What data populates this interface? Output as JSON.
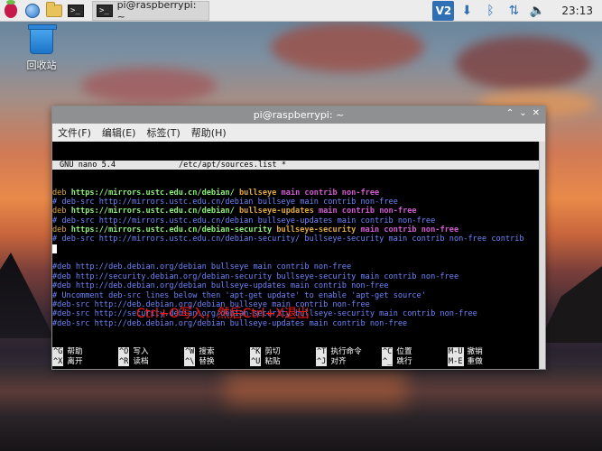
{
  "taskbar": {
    "launchers": [
      "raspberry-menu",
      "web-browser",
      "file-manager",
      "terminal"
    ],
    "active_task": "pi@raspberrypi: ~",
    "tray": {
      "vnc_label": "V2",
      "clock": "23:13"
    }
  },
  "desktop": {
    "icons": [
      {
        "label": "回收站",
        "icon": "trash-icon"
      }
    ]
  },
  "terminal": {
    "title": "pi@raspberrypi: ~",
    "menu": [
      "文件(F)",
      "编辑(E)",
      "标签(T)",
      "帮助(H)"
    ],
    "nano_header": {
      "version": "GNU nano 5.4",
      "file": "/etc/apt/sources.list *"
    },
    "lines": [
      [
        {
          "t": "deb ",
          "c": "deb"
        },
        {
          "t": "https://mirrors.ustc.edu.cn/debian/ ",
          "c": "url"
        },
        {
          "t": "bullseye ",
          "c": "dist"
        },
        {
          "t": "main contrib non-free",
          "c": "comp"
        }
      ],
      [
        {
          "t": "# deb-src http://mirrors.ustc.edu.cn/debian bullseye main contrib non-free",
          "c": "comment"
        }
      ],
      [
        {
          "t": "deb ",
          "c": "deb"
        },
        {
          "t": "https://mirrors.ustc.edu.cn/debian/ ",
          "c": "url"
        },
        {
          "t": "bullseye-updates ",
          "c": "dist"
        },
        {
          "t": "main contrib non-free",
          "c": "comp"
        }
      ],
      [
        {
          "t": "# deb-src http://mirrors.ustc.edu.cn/debian bullseye-updates main contrib non-free",
          "c": "comment"
        }
      ],
      [
        {
          "t": "deb ",
          "c": "deb"
        },
        {
          "t": "https://mirrors.ustc.edu.cn/debian-security ",
          "c": "url"
        },
        {
          "t": "bullseye-security ",
          "c": "dist"
        },
        {
          "t": "main contrib non-free",
          "c": "comp"
        }
      ],
      [
        {
          "t": "# deb-src http://mirrors.ustc.edu.cn/debian-security/ bullseye-security main contrib non-free contrib",
          "c": "comment"
        }
      ],
      [
        {
          "t": "",
          "c": "cursor"
        }
      ],
      [
        {
          "t": "",
          "c": "plain"
        }
      ],
      [
        {
          "t": "#deb http://deb.debian.org/debian bullseye main contrib non-free",
          "c": "comment"
        }
      ],
      [
        {
          "t": "#deb http://security.debian.org/debian-security bullseye-security main contrib non-free",
          "c": "comment"
        }
      ],
      [
        {
          "t": "#deb http://deb.debian.org/debian bullseye-updates main contrib non-free",
          "c": "comment"
        }
      ],
      [
        {
          "t": "# Uncomment deb-src lines below then 'apt-get update' to enable 'apt-get source'",
          "c": "comment"
        }
      ],
      [
        {
          "t": "#deb-src http://deb.debian.org/debian bullseye main contrib non-free",
          "c": "comment"
        }
      ],
      [
        {
          "t": "#deb-src http://security.debian.org/debian-security bullseye-security main contrib non-free",
          "c": "comment"
        }
      ],
      [
        {
          "t": "#deb-src http://deb.debian.org/debian bullseye-updates main contrib non-free",
          "c": "comment"
        }
      ]
    ],
    "annotation": "Ctrl+O写入，然后Ctrl+X退出",
    "shortcuts": [
      [
        {
          "k": "^G",
          "l": "帮助"
        },
        {
          "k": "^O",
          "l": "写入"
        },
        {
          "k": "^W",
          "l": "搜索"
        },
        {
          "k": "^K",
          "l": "剪切"
        },
        {
          "k": "^T",
          "l": "执行命令"
        },
        {
          "k": "^C",
          "l": "位置"
        },
        {
          "k": "M-U",
          "l": "撤销"
        }
      ],
      [
        {
          "k": "^X",
          "l": "离开"
        },
        {
          "k": "^R",
          "l": "读档"
        },
        {
          "k": "^\\",
          "l": "替换"
        },
        {
          "k": "^U",
          "l": "粘贴"
        },
        {
          "k": "^J",
          "l": "对齐"
        },
        {
          "k": "^_",
          "l": "跳行"
        },
        {
          "k": "M-E",
          "l": "重做"
        }
      ]
    ]
  }
}
